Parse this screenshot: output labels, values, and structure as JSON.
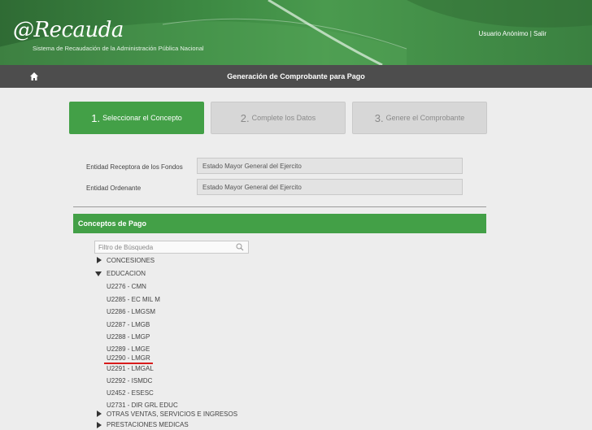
{
  "header": {
    "logo_prefix": "@",
    "logo_name": "Recauda",
    "subtitle": "Sistema de Recaudación de la Administración Pública Nacional",
    "user_links": "Usuario Anónimo | Salir"
  },
  "titlebar": {
    "title": "Generación de Comprobante para Pago",
    "home_icon": "home-icon"
  },
  "steps": [
    {
      "num": "1.",
      "label": "Seleccionar el Concepto",
      "state": "active"
    },
    {
      "num": "2.",
      "label": "Complete los Datos",
      "state": "inactive"
    },
    {
      "num": "3.",
      "label": "Genere el Comprobante",
      "state": "inactive"
    }
  ],
  "fields": [
    {
      "label": "Entidad Receptora de los Fondos",
      "value": "Estado Mayor General del Ejercito"
    },
    {
      "label": "Entidad Ordenante",
      "value": "Estado Mayor General del Ejercito"
    }
  ],
  "section": {
    "title": "Conceptos de Pago"
  },
  "search": {
    "placeholder": "Filtro de Búsqueda",
    "icon": "search-icon"
  },
  "tree": {
    "groups": [
      {
        "label": "CONCESIONES",
        "expanded": false
      },
      {
        "label": "EDUCACION",
        "expanded": true
      },
      {
        "label": "OTRAS VENTAS, SERVICIOS E INGRESOS",
        "expanded": false
      },
      {
        "label": "PRESTACIONES MEDICAS",
        "expanded": false
      }
    ],
    "education_items": [
      "U2276 - CMN",
      "U2285 - EC MIL M",
      "U2286 - LMGSM",
      "U2287 - LMGB",
      "U2288 - LMGP",
      "U2289 - LMGE",
      "U2290 - LMGR",
      "U2291 - LMGAL",
      "U2292 - ISMDC",
      "U2452 - ESESC",
      "U2731 - DIR GRL EDUC"
    ],
    "highlighted_item": "U2290 - LMGR",
    "highlight_color": "#d81b1b"
  },
  "colors": {
    "brand_green": "#43a047",
    "titlebar_gray": "#4d4d4d"
  }
}
